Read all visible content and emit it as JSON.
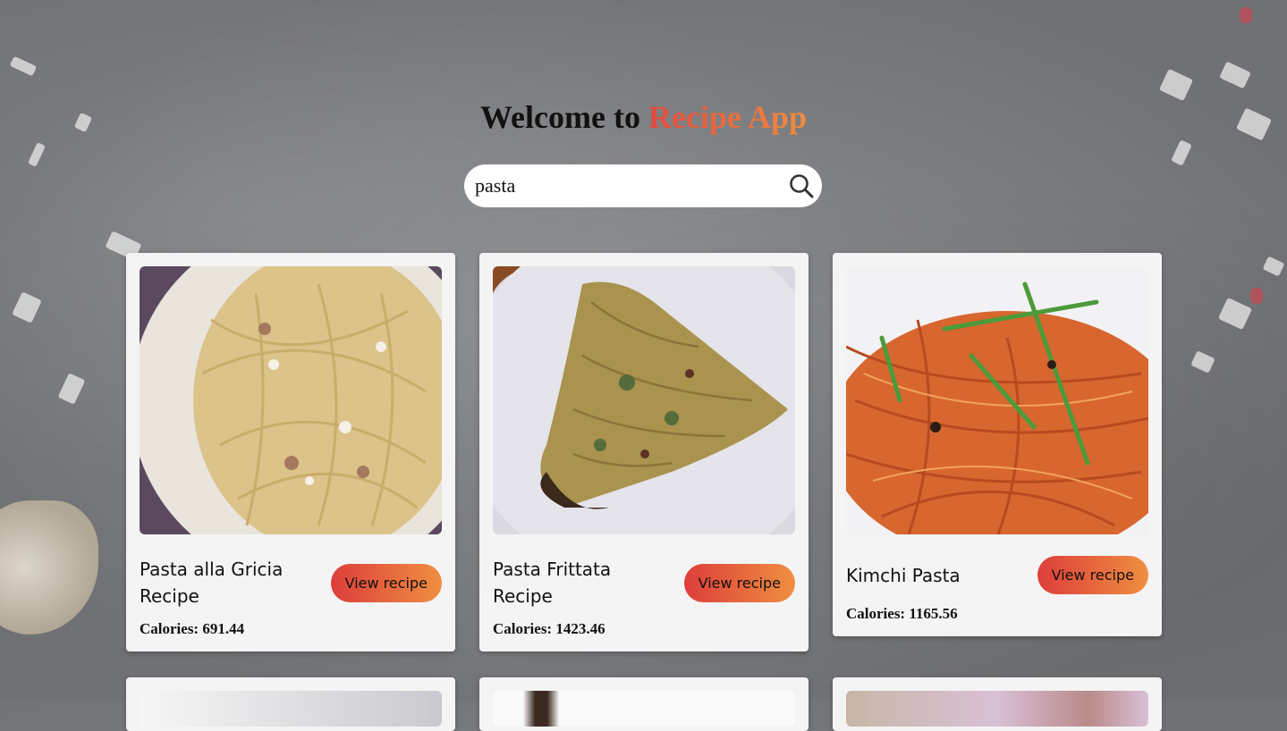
{
  "header": {
    "title_prefix": "Welcome to",
    "title_accent": "Recipe App",
    "accent_gradient": [
      "#e24a3f",
      "#ef8d3f"
    ]
  },
  "search": {
    "value": "pasta",
    "icon": "search-icon"
  },
  "recipes": [
    {
      "name": "Pasta alla Gricia Recipe",
      "calories": "Calories: 691.44",
      "button": "View recipe"
    },
    {
      "name": "Pasta Frittata Recipe",
      "calories": "Calories: 1423.46",
      "button": "View recipe"
    },
    {
      "name": "Kimchi Pasta",
      "calories": "Calories: 1165.56",
      "button": "View recipe"
    }
  ],
  "colors": {
    "card_bg": "#f4f4f4",
    "button_gradient": [
      "#dd3e3b",
      "#ef8f41"
    ]
  }
}
